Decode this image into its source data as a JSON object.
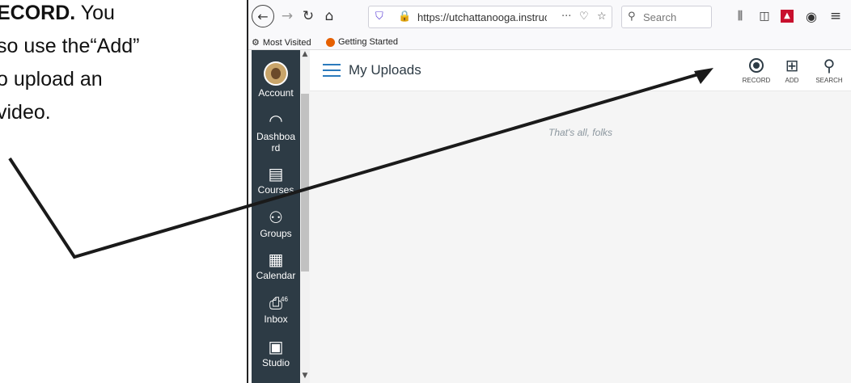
{
  "instructions": {
    "line1_bold": "ECORD.",
    "line1_rest": "You",
    "line2": "so use the“Add”",
    "line3": "o upload an",
    "line4": "video."
  },
  "browser": {
    "url": "https://utchattanooga.instruc",
    "search_placeholder": "Search",
    "overflow_dots": "···",
    "bookmarks": [
      {
        "label": "Most Visited",
        "icon": "gear-icon"
      },
      {
        "label": "Getting Started",
        "icon": "firefox-icon"
      }
    ]
  },
  "nav": {
    "items": [
      {
        "label": "Account",
        "icon": "avatar"
      },
      {
        "label": "Dashboa\nrd",
        "icon": "dashboard-icon"
      },
      {
        "label": "Courses",
        "icon": "courses-icon"
      },
      {
        "label": "Groups",
        "icon": "groups-icon"
      },
      {
        "label": "Calendar",
        "icon": "calendar-icon"
      },
      {
        "label": "Inbox",
        "icon": "inbox-icon",
        "badge": "46"
      },
      {
        "label": "Studio",
        "icon": "studio-icon"
      }
    ]
  },
  "header": {
    "title": "My Uploads",
    "actions": [
      {
        "label": "RECORD",
        "icon": "record-icon"
      },
      {
        "label": "ADD",
        "icon": "add-media-icon"
      },
      {
        "label": "SEARCH",
        "icon": "search-icon"
      }
    ]
  },
  "content": {
    "empty_message": "That's all, folks"
  },
  "colors": {
    "nav_bg": "#2d3b45",
    "accent": "#2b7abc",
    "content_bg": "#f5f5f5"
  }
}
